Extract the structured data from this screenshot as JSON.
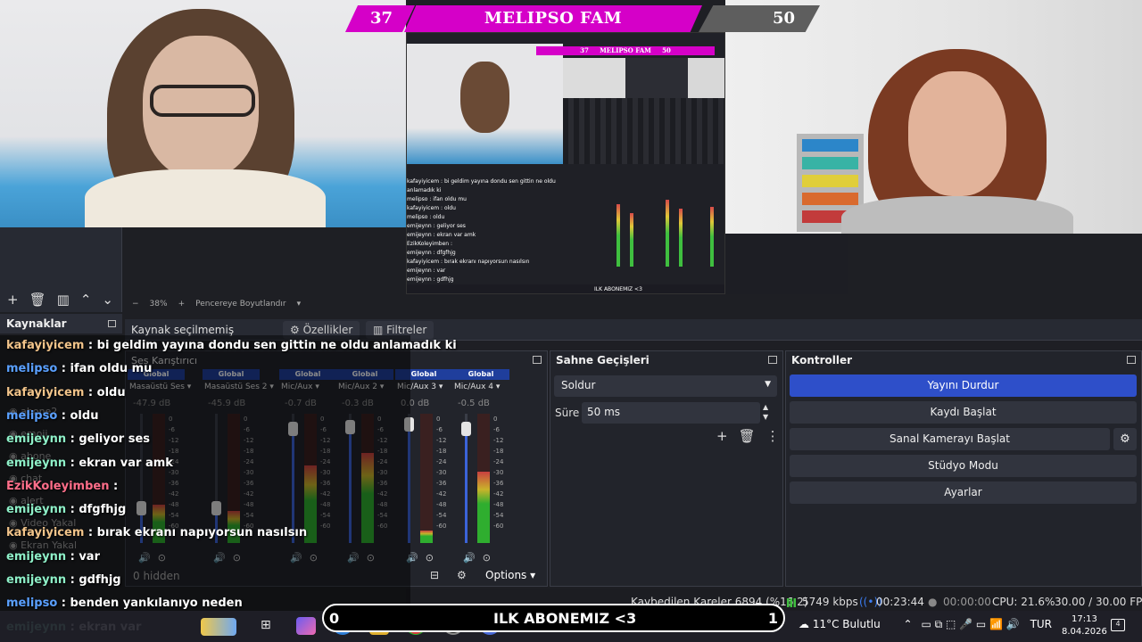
{
  "scoreboard": {
    "left_score": "37",
    "title": "MELIPSO FAM",
    "right_score": "50"
  },
  "nested": {
    "score_title": "MELIPSO FAM",
    "score_left": "37",
    "score_right": "50",
    "chat": [
      "kafayiyicem : bi geldim yayına dondu sen gittin ne oldu anlamadık ki",
      "melipso : ifan oldu mu",
      "kafayiyicem : oldu",
      "melipso : oldu",
      "emijeynn : geliyor ses",
      "emijeynn : ekran var amk",
      "EzikKoleyimben :",
      "emijeynn : dfgfhjg",
      "kafayiyicem : bırak ekranı napıyorsun nasılsın",
      "emijeynn : var",
      "emijeynn : gdfhjg",
      "melipso : benden yankılanıyo neden"
    ],
    "goal_text": "ILK ABONEMIZ <3"
  },
  "obs": {
    "zoom_minus": "−",
    "zoom_value": "38%",
    "zoom_plus": "+",
    "fit_label": "Pencereye Boyutlandır",
    "sources_header": "Kaynaklar",
    "no_source": "Kaynak seçilmemiş",
    "properties_btn": "Özellikler",
    "filters_btn": "Filtreler",
    "mixer_title": "Ses Karıştırıcı",
    "hidden_count": "0 hidden",
    "options_label": "Options",
    "channels": [
      {
        "tag": "Global",
        "name": "Masaüstü Ses",
        "db": "-47.9 dB",
        "level": 0.3,
        "fader": 0.27
      },
      {
        "tag": "Global",
        "name": "Masaüstü Ses 2",
        "db": "-45.9 dB",
        "level": 0.25,
        "fader": 0.27
      },
      {
        "tag": "Global",
        "name": "Mic/Aux",
        "db": "-0.7 dB",
        "level": 0.6,
        "fader": 0.88
      },
      {
        "tag": "Global",
        "name": "Mic/Aux 2",
        "db": "-0.3 dB",
        "level": 0.7,
        "fader": 0.9
      },
      {
        "tag": "Global",
        "name": "Mic/Aux 3",
        "db": "0.0 dB",
        "level": 0.1,
        "fader": 0.92
      },
      {
        "tag": "Global",
        "name": "Mic/Aux 4",
        "db": "-0.5 dB",
        "level": 0.55,
        "fader": 0.88
      }
    ],
    "meter_ticks": [
      "0",
      "-6",
      "-12",
      "-18",
      "-24",
      "-30",
      "-36",
      "-42",
      "-48",
      "-54",
      "-60"
    ],
    "sources": [
      "abone2",
      "emoji",
      "abone",
      "chat",
      "alert",
      "Video Yakal",
      "Ekran Yakal"
    ],
    "transitions": {
      "title": "Sahne Geçişleri",
      "selected": "Soldur",
      "duration_label": "Süre",
      "duration_value": "50 ms"
    },
    "controls": {
      "title": "Kontroller",
      "stop_stream": "Yayını Durdur",
      "start_record": "Kaydı Başlat",
      "virtual_cam": "Sanal Kamerayı Başlat",
      "studio_mode": "Stüdyo Modu",
      "settings": "Ayarlar"
    },
    "status": {
      "dropped": "Kaybedilen Kareler 6894 (%16.2)",
      "bitrate": "5749 kbps",
      "live_time": "00:23:44",
      "rec_time": "00:00:00",
      "cpu": "CPU: 21.6%",
      "fps": "30.00 / 30.00 FPS"
    }
  },
  "chat": [
    {
      "user": "kafayiyicem",
      "text": " : bi geldim yayına dondu sen gittin ne oldu anlamadık ki",
      "color": "#f2c48a"
    },
    {
      "user": "melipso",
      "text": " : ifan oldu mu",
      "color": "#5aa0ff"
    },
    {
      "user": "kafayiyicem",
      "text": " : oldu",
      "color": "#f2c48a"
    },
    {
      "user": "melipso",
      "text": " : oldu",
      "color": "#5aa0ff"
    },
    {
      "user": "emijeynn",
      "text": " : geliyor ses",
      "color": "#8ef0c8"
    },
    {
      "user": "emijeynn",
      "text": " : ekran var amk",
      "color": "#8ef0c8"
    },
    {
      "user": "EzikKoleyimben",
      "text": " :",
      "color": "#ff6e8a"
    },
    {
      "user": "emijeynn",
      "text": " : dfgfhjg",
      "color": "#8ef0c8"
    },
    {
      "user": "kafayiyicem",
      "text": " : bırak ekranı napıyorsun nasılsın",
      "color": "#f2c48a"
    },
    {
      "user": "emijeynn",
      "text": " : var",
      "color": "#8ef0c8"
    },
    {
      "user": "emijeynn",
      "text": " : gdfhjg",
      "color": "#8ef0c8"
    },
    {
      "user": "melipso",
      "text": " : benden yankılanıyo neden",
      "color": "#5aa0ff"
    },
    {
      "user": "emijeynn",
      "text": " : ekran var",
      "color": "#8ef0c8"
    }
  ],
  "goal": {
    "start": "0",
    "text": "ILK ABONEMIZ <3",
    "end": "1"
  },
  "taskbar": {
    "weather": "11°C  Bulutlu",
    "lang": "TUR",
    "time": "17:13",
    "date": "8.04.2026",
    "notif": "4"
  }
}
